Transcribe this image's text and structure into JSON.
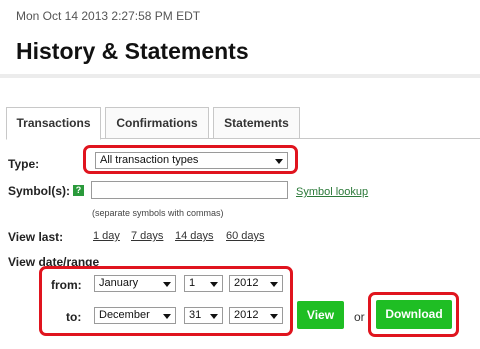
{
  "header": {
    "timestamp": "Mon Oct 14 2013 2:27:58 PM EDT",
    "title": "History & Statements"
  },
  "tabs": [
    {
      "label": "Transactions",
      "active": true
    },
    {
      "label": "Confirmations",
      "active": false
    },
    {
      "label": "Statements",
      "active": false
    }
  ],
  "form": {
    "type_label": "Type:",
    "type_value": "All transaction types",
    "symbol_label": "Symbol(s):",
    "symbol_help": "?",
    "symbol_value": "",
    "symbol_lookup": "Symbol lookup",
    "symbol_hint": "(separate symbols with commas)",
    "view_last_label": "View last:",
    "view_last_options": [
      "1 day",
      "7 days",
      "14 days",
      "60 days"
    ],
    "date_range_label": "View date/range",
    "from_label": "from:",
    "to_label": "to:",
    "from": {
      "month": "January",
      "day": "1",
      "year": "2012"
    },
    "to": {
      "month": "December",
      "day": "31",
      "year": "2012"
    }
  },
  "actions": {
    "view_label": "View",
    "or_text": "or",
    "download_label": "Download"
  },
  "colors": {
    "accent_green": "#1fbe24",
    "highlight_red": "#e0141e",
    "link_green": "#2c7a3a"
  }
}
